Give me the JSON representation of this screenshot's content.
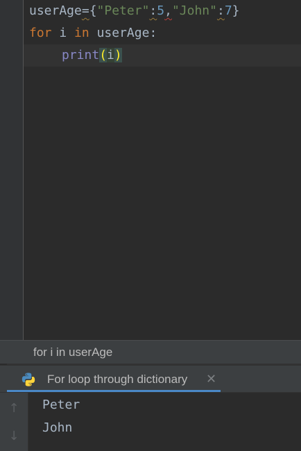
{
  "editor": {
    "line1": {
      "var": "userAge",
      "eq": "=",
      "brace_open": "{",
      "key1": "\"Peter\"",
      "colon1": ":",
      "val1": "5",
      "comma": ",",
      "key2": "\"John\"",
      "colon2": ":",
      "val2": "7",
      "brace_close": "}"
    },
    "line2": {
      "kw_for": "for",
      "var_i": "i",
      "kw_in": "in",
      "iterable": "userAge",
      "colon": ":"
    },
    "line3": {
      "func": "print",
      "paren_open": "(",
      "arg": "i",
      "paren_close": ")"
    }
  },
  "breadcrumb": {
    "text": "for i in userAge"
  },
  "run_panel": {
    "tab_label": "For loop through dictionary",
    "close_glyph": "✕",
    "up_glyph": "↑",
    "down_glyph": "↓",
    "output": [
      "Peter",
      "John"
    ]
  },
  "colors": {
    "keyword": "#cc7832",
    "string": "#6a8759",
    "number": "#6897bb",
    "builtin": "#8888c6",
    "text": "#a9b7c6",
    "accent": "#4a88c7"
  },
  "icons": {
    "run_tab_icon": "python-icon"
  }
}
